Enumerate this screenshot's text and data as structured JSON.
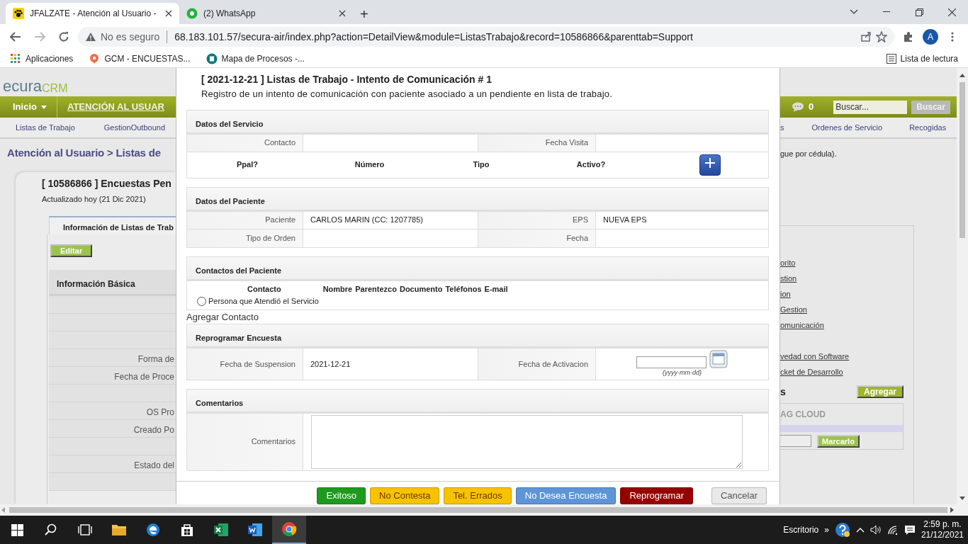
{
  "browser": {
    "tabs": [
      {
        "title": "JFALZATE - Atención al Usuario -",
        "selected": true
      },
      {
        "title": "(2) WhatsApp",
        "selected": false
      }
    ],
    "new_tab": "+",
    "address": {
      "security": "No es seguro",
      "url": "68.183.101.57/secura-air/index.php?action=DetailView&module=ListasTrabajo&record=10586866&parenttab=Support"
    },
    "profile": "A",
    "bookmarks": [
      "Aplicaciones",
      "GCM - ENCUESTAS...",
      "Mapa de Procesos -..."
    ],
    "reading_list": "Lista de lectura"
  },
  "crm": {
    "logo": {
      "prefix": "ecura",
      "suffix": "CRM"
    },
    "menu": [
      {
        "label": "Inicio",
        "dropdown": true
      },
      {
        "label": "ATENCIÓN AL USUAR",
        "dropdown": false
      }
    ],
    "chat_count": "0",
    "search": {
      "placeholder": "Buscar...",
      "button": "Buscar"
    },
    "submenu_left": [
      "Listas de Trabajo",
      "GestionOutbound"
    ],
    "submenu_right": [
      "s",
      "Ordenes de Servicio",
      "Recogidas"
    ],
    "breadcrumb": "Atención al Usuario > Listas de",
    "record": {
      "title": "[ 10586866 ] Encuestas Pen",
      "updated": "Actualizado hoy (21 Dic 2021)",
      "tab": "Información de Listas de Trab",
      "edit_button": "Editar",
      "block_title": "Información Básica",
      "rows": [
        {},
        {},
        {},
        {
          "label": "Forma de"
        },
        {
          "label": "Fecha de Proce"
        },
        {},
        {
          "label": "OS Pro"
        },
        {
          "label": "Creado Po"
        },
        {},
        {
          "label": "Estado del"
        },
        {}
      ]
    },
    "note": "gue por cédula).",
    "links": [
      "orito",
      "stion",
      "ion",
      "Gestion",
      "omunicación",
      "vedad con Software",
      "cket de Desarrollo"
    ],
    "tags": {
      "heading": "s",
      "add_button": "Agregar",
      "cloud_title": "AG CLOUD",
      "tag_button": "Marcarlo"
    }
  },
  "modal": {
    "title": "[ 2021-12-21 ] Listas de Trabajo - Intento de Comunicación # 1",
    "subtitle": "Registro de un intento de comunicación con paciente asociado a un pendiente en lista de trabajo.",
    "sections": [
      {
        "kind": "fields",
        "title": "Datos del Servicio",
        "rows": [
          [
            {
              "kind": "text",
              "label": "Contacto"
            },
            {
              "kind": "text",
              "label": "Fecha Visita"
            }
          ]
        ],
        "phone_headers": [
          "Ppal?",
          "Número",
          "Tipo",
          "Activo?"
        ]
      },
      {
        "kind": "fields",
        "title": "Datos del Paciente",
        "rows": [
          [
            {
              "kind": "text",
              "label": "Paciente",
              "value": "CARLOS MARIN (CC: 1207785)"
            },
            {
              "kind": "text",
              "label": "EPS",
              "value": "NUEVA EPS"
            }
          ],
          [
            {
              "kind": "text",
              "label": "Tipo de Orden"
            },
            {
              "kind": "text",
              "label": "Fecha"
            }
          ]
        ]
      },
      {
        "kind": "contacts",
        "title": "Contactos del Paciente",
        "columns": [
          "Contacto",
          "Nombre",
          "Parentezco",
          "Documento",
          "Teléfonos",
          "E-mail"
        ],
        "options": [
          {
            "label": "Persona que Atendió el Servicio",
            "selected": false
          }
        ],
        "add_link": "Agregar Contacto"
      },
      {
        "kind": "fields",
        "title": "Reprogramar Encuesta",
        "rows": [
          [
            {
              "kind": "text",
              "label": "Fecha de Suspension",
              "value": "2021-12-21"
            },
            {
              "kind": "date",
              "label": "Fecha de Activacion",
              "hint": "(yyyy-mm-dd)"
            }
          ]
        ]
      },
      {
        "kind": "comments",
        "title": "Comentarios",
        "label": "Comentarios"
      }
    ],
    "buttons": [
      {
        "label": "Exitoso",
        "color": "#1e9a1e"
      },
      {
        "label": "No Contesta",
        "color": "#f7c200"
      },
      {
        "label": "Tel. Errados",
        "color": "#f7c200"
      },
      {
        "label": "No Desea Encuesta",
        "color": "#5d95d8"
      },
      {
        "label": "Reprogramar",
        "color": "#970000"
      },
      {
        "label": "Cancelar",
        "color": "#e9e9e9"
      }
    ]
  },
  "taskbar": {
    "apps": [
      {
        "selected": false
      },
      {
        "selected": false
      },
      {
        "selected": false
      },
      {
        "selected": false
      },
      {
        "selected": false
      },
      {
        "selected": false
      },
      {
        "selected": true
      }
    ],
    "desktop_label": "Escritorio",
    "overflow": "»",
    "time": "2:59 p. m.",
    "date": "21/12/2021"
  }
}
